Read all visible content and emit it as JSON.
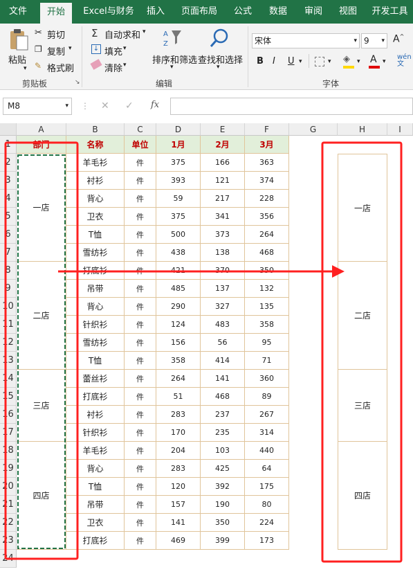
{
  "ribbon_tabs": [
    "文件",
    "开始",
    "Excel与财务",
    "插入",
    "页面布局",
    "公式",
    "数据",
    "审阅",
    "视图",
    "开发工具"
  ],
  "clipboard": {
    "paste": "粘贴",
    "cut": "剪切",
    "copy": "复制",
    "format_painter": "格式刷",
    "group_label": "剪贴板"
  },
  "editing": {
    "autosum": "自动求和",
    "fill": "填充",
    "clear": "清除",
    "sort_filter": "排序和筛选",
    "find_select": "查找和选择",
    "group_label": "编辑"
  },
  "font": {
    "name": "宋体",
    "size": "9",
    "group_label": "字体"
  },
  "formula_bar": {
    "name_box": "M8",
    "formula": ""
  },
  "columns": [
    "A",
    "B",
    "C",
    "D",
    "E",
    "F",
    "G",
    "H",
    "I"
  ],
  "headers": {
    "dept": "部门",
    "item": "名称",
    "unit": "单位",
    "m1": "1月",
    "m2": "2月",
    "m3": "3月"
  },
  "rows": [
    {
      "name": "羊毛衫",
      "unit": "件",
      "m1": "375",
      "m2": "166",
      "m3": "363"
    },
    {
      "name": "衬衫",
      "unit": "件",
      "m1": "393",
      "m2": "121",
      "m3": "374"
    },
    {
      "name": "背心",
      "unit": "件",
      "m1": "59",
      "m2": "217",
      "m3": "228"
    },
    {
      "name": "卫衣",
      "unit": "件",
      "m1": "375",
      "m2": "341",
      "m3": "356"
    },
    {
      "name": "T恤",
      "unit": "件",
      "m1": "500",
      "m2": "373",
      "m3": "264"
    },
    {
      "name": "雪纺衫",
      "unit": "件",
      "m1": "438",
      "m2": "138",
      "m3": "468"
    },
    {
      "name": "打底衫",
      "unit": "件",
      "m1": "421",
      "m2": "370",
      "m3": "350"
    },
    {
      "name": "吊带",
      "unit": "件",
      "m1": "485",
      "m2": "137",
      "m3": "132"
    },
    {
      "name": "背心",
      "unit": "件",
      "m1": "290",
      "m2": "327",
      "m3": "135"
    },
    {
      "name": "针织衫",
      "unit": "件",
      "m1": "124",
      "m2": "483",
      "m3": "358"
    },
    {
      "name": "雪纺衫",
      "unit": "件",
      "m1": "156",
      "m2": "56",
      "m3": "95"
    },
    {
      "name": "T恤",
      "unit": "件",
      "m1": "358",
      "m2": "414",
      "m3": "71"
    },
    {
      "name": "蕾丝衫",
      "unit": "件",
      "m1": "264",
      "m2": "141",
      "m3": "360"
    },
    {
      "name": "打底衫",
      "unit": "件",
      "m1": "51",
      "m2": "468",
      "m3": "89"
    },
    {
      "name": "衬衫",
      "unit": "件",
      "m1": "283",
      "m2": "237",
      "m3": "267"
    },
    {
      "name": "针织衫",
      "unit": "件",
      "m1": "170",
      "m2": "235",
      "m3": "314"
    },
    {
      "name": "羊毛衫",
      "unit": "件",
      "m1": "204",
      "m2": "103",
      "m3": "440"
    },
    {
      "name": "背心",
      "unit": "件",
      "m1": "283",
      "m2": "425",
      "m3": "64"
    },
    {
      "name": "T恤",
      "unit": "件",
      "m1": "120",
      "m2": "392",
      "m3": "175"
    },
    {
      "name": "吊带",
      "unit": "件",
      "m1": "157",
      "m2": "190",
      "m3": "80"
    },
    {
      "name": "卫衣",
      "unit": "件",
      "m1": "141",
      "m2": "350",
      "m3": "224"
    },
    {
      "name": "打底衫",
      "unit": "件",
      "m1": "469",
      "m2": "399",
      "m3": "173"
    }
  ],
  "departments": [
    {
      "name": "一店",
      "count": 6
    },
    {
      "name": "二店",
      "count": 6
    },
    {
      "name": "三店",
      "count": 4
    },
    {
      "name": "四店",
      "count": 6
    }
  ],
  "colors": {
    "ribbon": "#217346",
    "header_fill": "#e2efda",
    "header_text": "#c00000",
    "annotation": "#ff2020",
    "selection_dash": "#217346"
  }
}
